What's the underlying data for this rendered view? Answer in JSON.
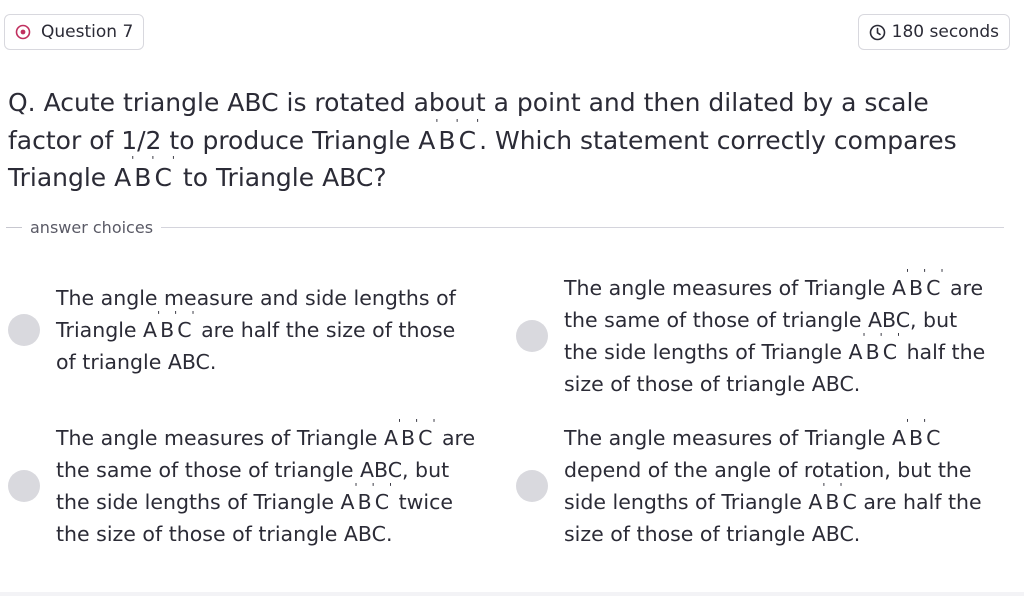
{
  "header": {
    "question_label": "Question 7",
    "timer_label": "180 seconds",
    "accent_color": "#c0305f"
  },
  "question": {
    "prompt_part1": "Q. Acute triangle ABC is rotated about a point and then dilated by a scale factor of 1/2 to produce Triangle A",
    "prime": "'",
    "B": "B",
    "C": "C",
    "prompt_part2": ". Which statement correctly compares Triangle A",
    "prompt_part3": " to Triangle ABC?"
  },
  "answers": {
    "section_label": "answer choices",
    "choices": [
      {
        "pre": "The angle measure and side lengths of Triangle A",
        "post": " are half the size of those of triangle ABC."
      },
      {
        "pre": "The angle measures of Triangle A",
        "mid": " are the same of those of triangle ABC, but the side lengths of Triangle A",
        "post": " half the size of those of triangle ABC."
      },
      {
        "pre": "The angle measures of Triangle A",
        "mid": " are the same of those of triangle ABC, but the side lengths of Triangle A",
        "post": " twice the size of those of triangle ABC."
      },
      {
        "pre": "The angle measures of Triangle A",
        "mid": "C depend of the angle of rotation, but the side lengths of Triangle A",
        "post": "C are half the size of those of triangle ABC."
      }
    ]
  }
}
